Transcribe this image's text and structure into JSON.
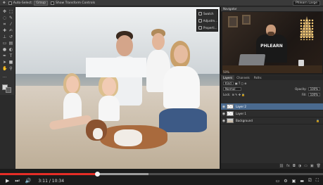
{
  "options_bar": {
    "auto_select_label": "Auto-Select:",
    "auto_select_value": "Group",
    "transform_controls_label": "Show Transform Controls",
    "workspace": "Phlearn Large"
  },
  "tools": [
    "move",
    "marquee",
    "lasso",
    "quick-select",
    "crop",
    "eyedropper",
    "healing",
    "brush",
    "stamp",
    "history",
    "eraser",
    "gradient",
    "blur",
    "dodge",
    "pen",
    "type",
    "path-select",
    "shape",
    "hand",
    "zoom"
  ],
  "props_panel": {
    "items": [
      {
        "label": "Swatch",
        "icon": "swatch-icon"
      },
      {
        "label": "Adjustm...",
        "icon": "adjustments-icon"
      },
      {
        "label": "Properti...",
        "icon": "properties-icon"
      }
    ]
  },
  "navigator": {
    "title": "Navigator",
    "zoom": "50%",
    "shirt_text": "PHLEARN"
  },
  "layers_panel": {
    "tabs": [
      "Layers",
      "Channels",
      "Paths"
    ],
    "active_tab": "Layers",
    "kind_label": "Kind",
    "blend_mode": "Normal",
    "opacity_label": "Opacity:",
    "opacity_value": "100%",
    "lock_label": "Lock:",
    "fill_label": "Fill:",
    "fill_value": "100%",
    "layers": [
      {
        "name": "Layer 2",
        "selected": true,
        "thumb": "checker"
      },
      {
        "name": "Layer 1",
        "selected": false,
        "thumb": "checker"
      },
      {
        "name": "Background",
        "selected": false,
        "thumb": "photo",
        "locked": true
      }
    ]
  },
  "player": {
    "current_time": "3:11",
    "separator": " / ",
    "duration": "10:34",
    "played_fraction": 0.301,
    "buffered_fraction": 0.46
  },
  "colors": {
    "accent_red": "#e52d27",
    "selected_layer": "#4a6a8f"
  }
}
